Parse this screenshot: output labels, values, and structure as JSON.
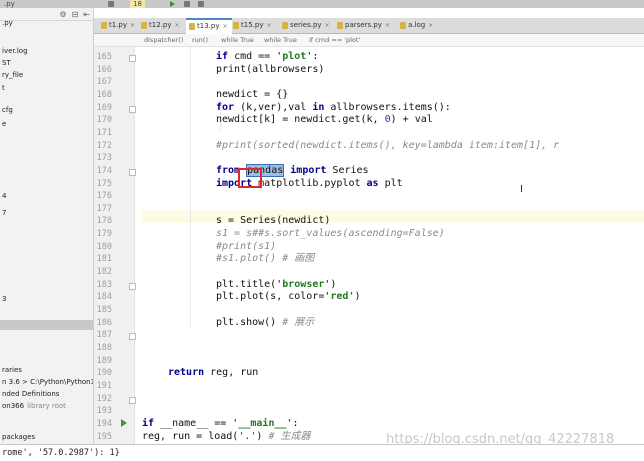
{
  "topbar": {
    "breadcrumb_file": ".py",
    "selected_item": "18"
  },
  "sidebar": {
    "rows": [
      {
        "text": ".py"
      },
      {
        "text": "iver.log"
      },
      {
        "text": "ST"
      },
      {
        "text": "ry_file"
      },
      {
        "text": "t"
      },
      {
        "text": "cfg"
      },
      {
        "text": "e"
      },
      {
        "text": "4"
      },
      {
        "text": "7"
      },
      {
        "text": "3"
      },
      {
        "text": "raries"
      },
      {
        "text": "n 3.6 > C:\\Python\\Python366"
      },
      {
        "text": "nded Definitions"
      },
      {
        "text": "on366",
        "extra": "library root"
      },
      {
        "text": "packages"
      }
    ]
  },
  "tabs": [
    {
      "label": "t1.py"
    },
    {
      "label": "t12.py"
    },
    {
      "label": "t13.py",
      "active": true
    },
    {
      "label": "t15.py"
    },
    {
      "label": "series.py"
    },
    {
      "label": "parsers.py"
    },
    {
      "label": "a.log"
    }
  ],
  "breadcrumbs": [
    "dispatcher()",
    "run()",
    "while True",
    "while True",
    "if cmd == 'plot'"
  ],
  "line_numbers": [
    "165",
    "166",
    "167",
    "168",
    "169",
    "170",
    "171",
    "172",
    "173",
    "174",
    "175",
    "176",
    "177",
    "178",
    "179",
    "180",
    "181",
    "182",
    "183",
    "184",
    "185",
    "186",
    "187",
    "188",
    "189",
    "190",
    "191",
    "192",
    "193",
    "194",
    "195"
  ],
  "code_lines": [
    {
      "n": "165",
      "indent": 0,
      "html": "    <span class='kw'>if</span> cmd == <span class='str'>'plot'</span>:"
    },
    {
      "n": "166",
      "html": "        print(allbrowsers)"
    },
    {
      "n": "167",
      "html": ""
    },
    {
      "n": "168",
      "html": "        newdict = {}"
    },
    {
      "n": "169",
      "html": "        <span class='kw'>for</span> (k,ver),val <span class='kw'>in</span> allbrowsers.items():"
    },
    {
      "n": "170",
      "html": "            newdict[k] = newdict.get(k, <span class='num'>0</span>) + val"
    },
    {
      "n": "171",
      "html": ""
    },
    {
      "n": "172",
      "html": "        <span class='cmt'>#print(sorted(newdict.items(), key=lambda item:item[1], r</span>"
    },
    {
      "n": "173",
      "html": ""
    },
    {
      "n": "174",
      "html": "        <span class='kw'>from</span> <span class='sel-word'>pandas</span> <span class='kw'>import</span> Series"
    },
    {
      "n": "175",
      "html": "        <span class='kw'>import</span> matplotlib.pyplot <span class='kw'>as</span> plt"
    },
    {
      "n": "176",
      "html": ""
    },
    {
      "n": "177",
      "html": ""
    },
    {
      "n": "178",
      "html": "        s = Series(newdict)"
    },
    {
      "n": "179",
      "html": "        <span class='cmt'>s1 = s##s.sort_values(ascending=False)</span>"
    },
    {
      "n": "180",
      "html": "        <span class='cmt'>#print(s1)</span>"
    },
    {
      "n": "181",
      "html": "        <span class='cmt'>#s1.plot() # 画图</span>"
    },
    {
      "n": "182",
      "html": ""
    },
    {
      "n": "183",
      "html": "        plt.title(<span class='str'>'browser'</span>)"
    },
    {
      "n": "184",
      "html": "        plt.plot(s, color=<span class='str'>'red'</span>)"
    },
    {
      "n": "185",
      "html": ""
    },
    {
      "n": "186",
      "html": "        plt.show() <span class='cmt'># 展示</span>"
    },
    {
      "n": "187",
      "html": ""
    },
    {
      "n": "188",
      "html": ""
    },
    {
      "n": "189",
      "html": ""
    },
    {
      "n": "190",
      "html": "<span class='kw'>return</span> reg, run"
    },
    {
      "n": "191",
      "html": ""
    },
    {
      "n": "192",
      "html": ""
    },
    {
      "n": "193",
      "html": ""
    },
    {
      "n": "194",
      "html": "<span class='kw'>if</span> __name__ == <span class='str'>'__main__'</span>:"
    },
    {
      "n": "195",
      "html": "    reg, run = load(<span class='num'>'.'</span>) <span class='cmt'># 生成器</span>"
    }
  ],
  "console": {
    "text": "rome', '57.0.2987'): 1}"
  },
  "watermark": "https://blog.csdn.net/qq_42227818"
}
